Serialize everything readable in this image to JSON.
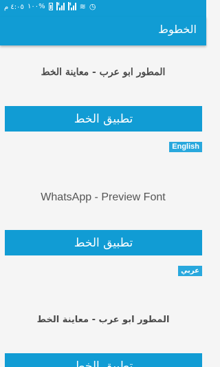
{
  "status_bar": {
    "time": "٤:٠٥ م",
    "battery_percent": "%١٠٠",
    "network_label": "H"
  },
  "app_bar": {
    "title": "الخطوط"
  },
  "fonts": [
    {
      "preview": "المطور ابو عرب - معاينة الخط",
      "apply_label": "تطبيق الخط"
    },
    {
      "badge": "English",
      "preview": "WhatsApp - Preview Font",
      "apply_label": "تطبيق الخط"
    },
    {
      "badge": "عربي",
      "preview": "المطور ابو عرب - معاينة الخط",
      "apply_label": "تطبيق الخط"
    }
  ],
  "colors": {
    "primary": "#119cd4",
    "badge": "#29a8dd",
    "background": "#f5f5f5",
    "preview_text": "#4a4a4a"
  }
}
